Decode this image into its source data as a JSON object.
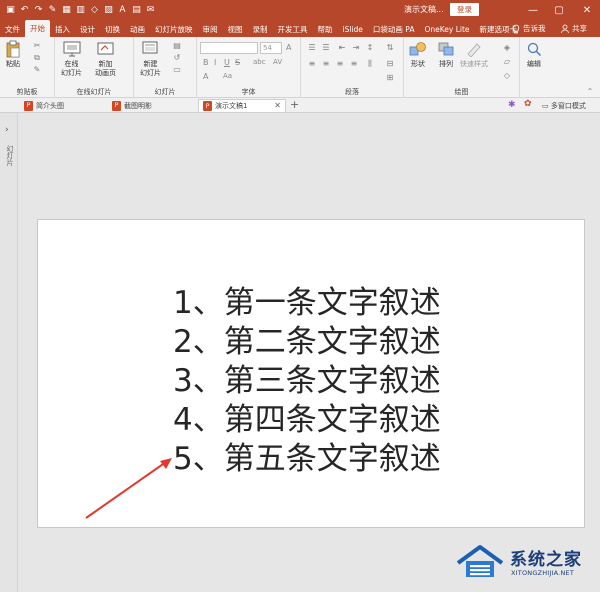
{
  "titlebar": {
    "qat_icons": [
      "save-icon",
      "undo-icon",
      "redo-icon",
      "format-painter-icon",
      "table-icon",
      "chart-icon",
      "shapes-icon",
      "picture-icon",
      "textbox-icon",
      "slides-icon",
      "comment-icon"
    ],
    "doc_title": "演示文稿...",
    "login": "登录",
    "minimize": "—",
    "restore": "▢",
    "close": "✕",
    "accent": "#b7472a"
  },
  "tabs": [
    "文件",
    "开始",
    "插入",
    "设计",
    "切换",
    "动画",
    "幻灯片放映",
    "审阅",
    "视图",
    "录制",
    "开发工具",
    "帮助",
    "iSlide",
    "口袋动画 PA",
    "OneKey Lite",
    "新建选项卡"
  ],
  "active_tab": "开始",
  "tell_me": "告诉我",
  "share": "共享",
  "ribbon": {
    "clipboard": {
      "paste": "粘贴",
      "label": "剪贴板"
    },
    "online_slides": {
      "online": "在线",
      "online2": "幻灯片",
      "new_anim": "新加",
      "new_anim2": "动画页",
      "label": "在线幻灯片"
    },
    "slides": {
      "new": "新建",
      "new2": "幻灯片",
      "label": "幻灯片"
    },
    "font": {
      "font_name": "",
      "font_size": "54",
      "bold": "B",
      "italic": "I",
      "underline": "U",
      "strike": "S",
      "shadow": "abc",
      "spacing": "AV",
      "case": "Aa",
      "label": "字体"
    },
    "paragraph": {
      "label": "段落"
    },
    "drawing": {
      "shape": "形状",
      "arrange": "排列",
      "quick_style": "快速样式",
      "label": "绘图"
    },
    "editing": {
      "edit": "编辑"
    }
  },
  "doc_tabs": [
    {
      "label": "简介头图",
      "active": false
    },
    {
      "label": "截图明影",
      "active": false
    },
    {
      "label": "演示文稿1",
      "active": true
    }
  ],
  "add_tab": "+",
  "multi_window": "多窗口模式",
  "left_strip_label": "幻灯片",
  "slide": {
    "lines": [
      "1、第一条文字叙述",
      "2、第二条文字叙述",
      "3、第三条文字叙述",
      "4、第四条文字叙述",
      "5、第五条文字叙述"
    ]
  },
  "arrow_color": "#e2382e",
  "watermark": {
    "title": "系统之家",
    "url": "XITONGZHIJIA.NET"
  }
}
